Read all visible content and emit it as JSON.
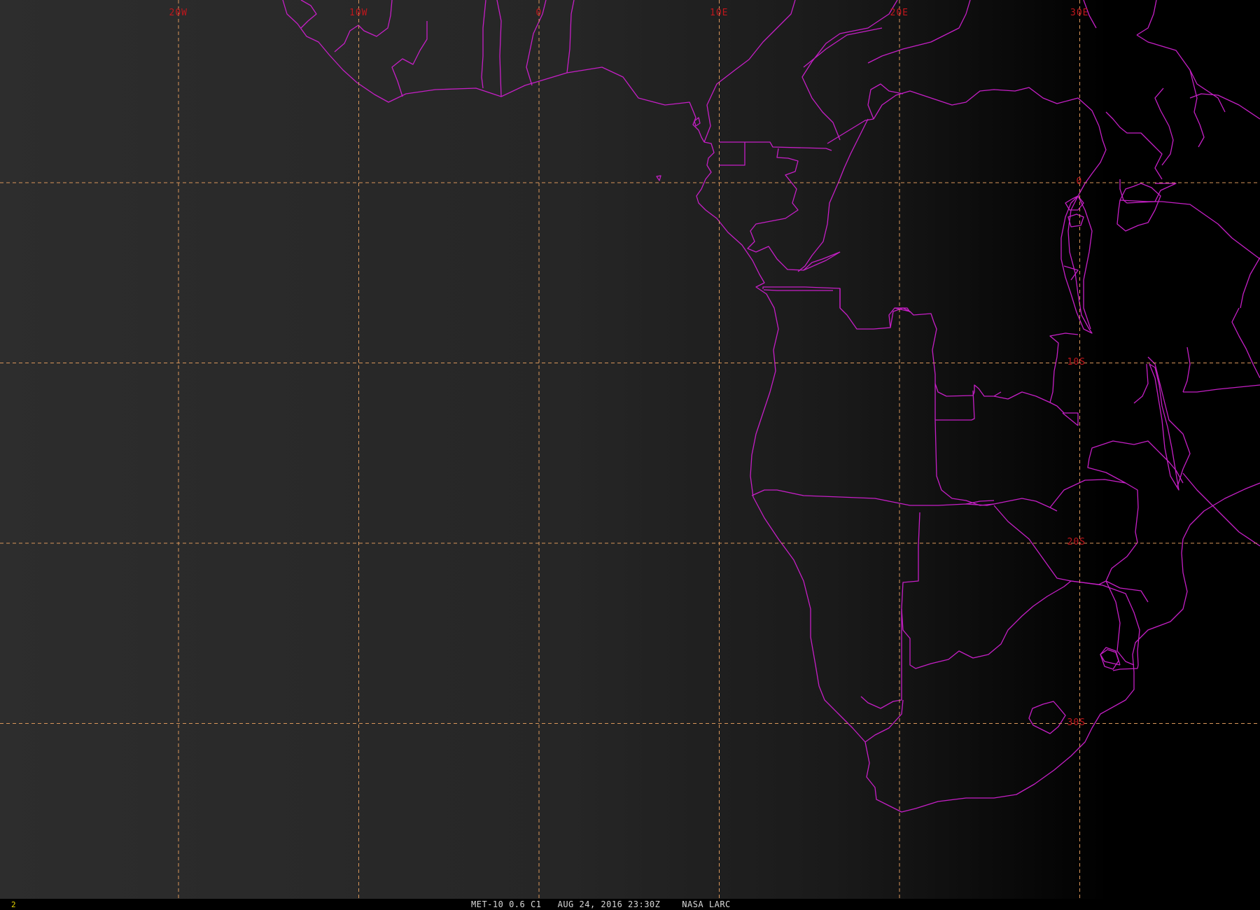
{
  "image": {
    "satellite_caption": "MET-10 0.6 C1   AUG 24, 2016 23:30Z    NASA LARC",
    "frame_number": "2",
    "colors": {
      "background_lit": "#2a2a2a",
      "background_dark": "#000000",
      "coastline": "#c51fc5",
      "gridline": "#d9965a",
      "grid_label": "#c0161c",
      "frame_number": "#e6d400",
      "caption": "#d8d8d8"
    }
  },
  "grid": {
    "longitudes": [
      {
        "value": -20,
        "label": "20W"
      },
      {
        "value": -10,
        "label": "10W"
      },
      {
        "value": 0,
        "label": "0"
      },
      {
        "value": 10,
        "label": "10E"
      },
      {
        "value": 20,
        "label": "20E"
      },
      {
        "value": 30,
        "label": "30E"
      }
    ],
    "latitudes": [
      {
        "value": 0,
        "label": "0"
      },
      {
        "value": -10,
        "label": "10S"
      },
      {
        "value": -20,
        "label": "20S"
      },
      {
        "value": -30,
        "label": "30S"
      }
    ]
  }
}
